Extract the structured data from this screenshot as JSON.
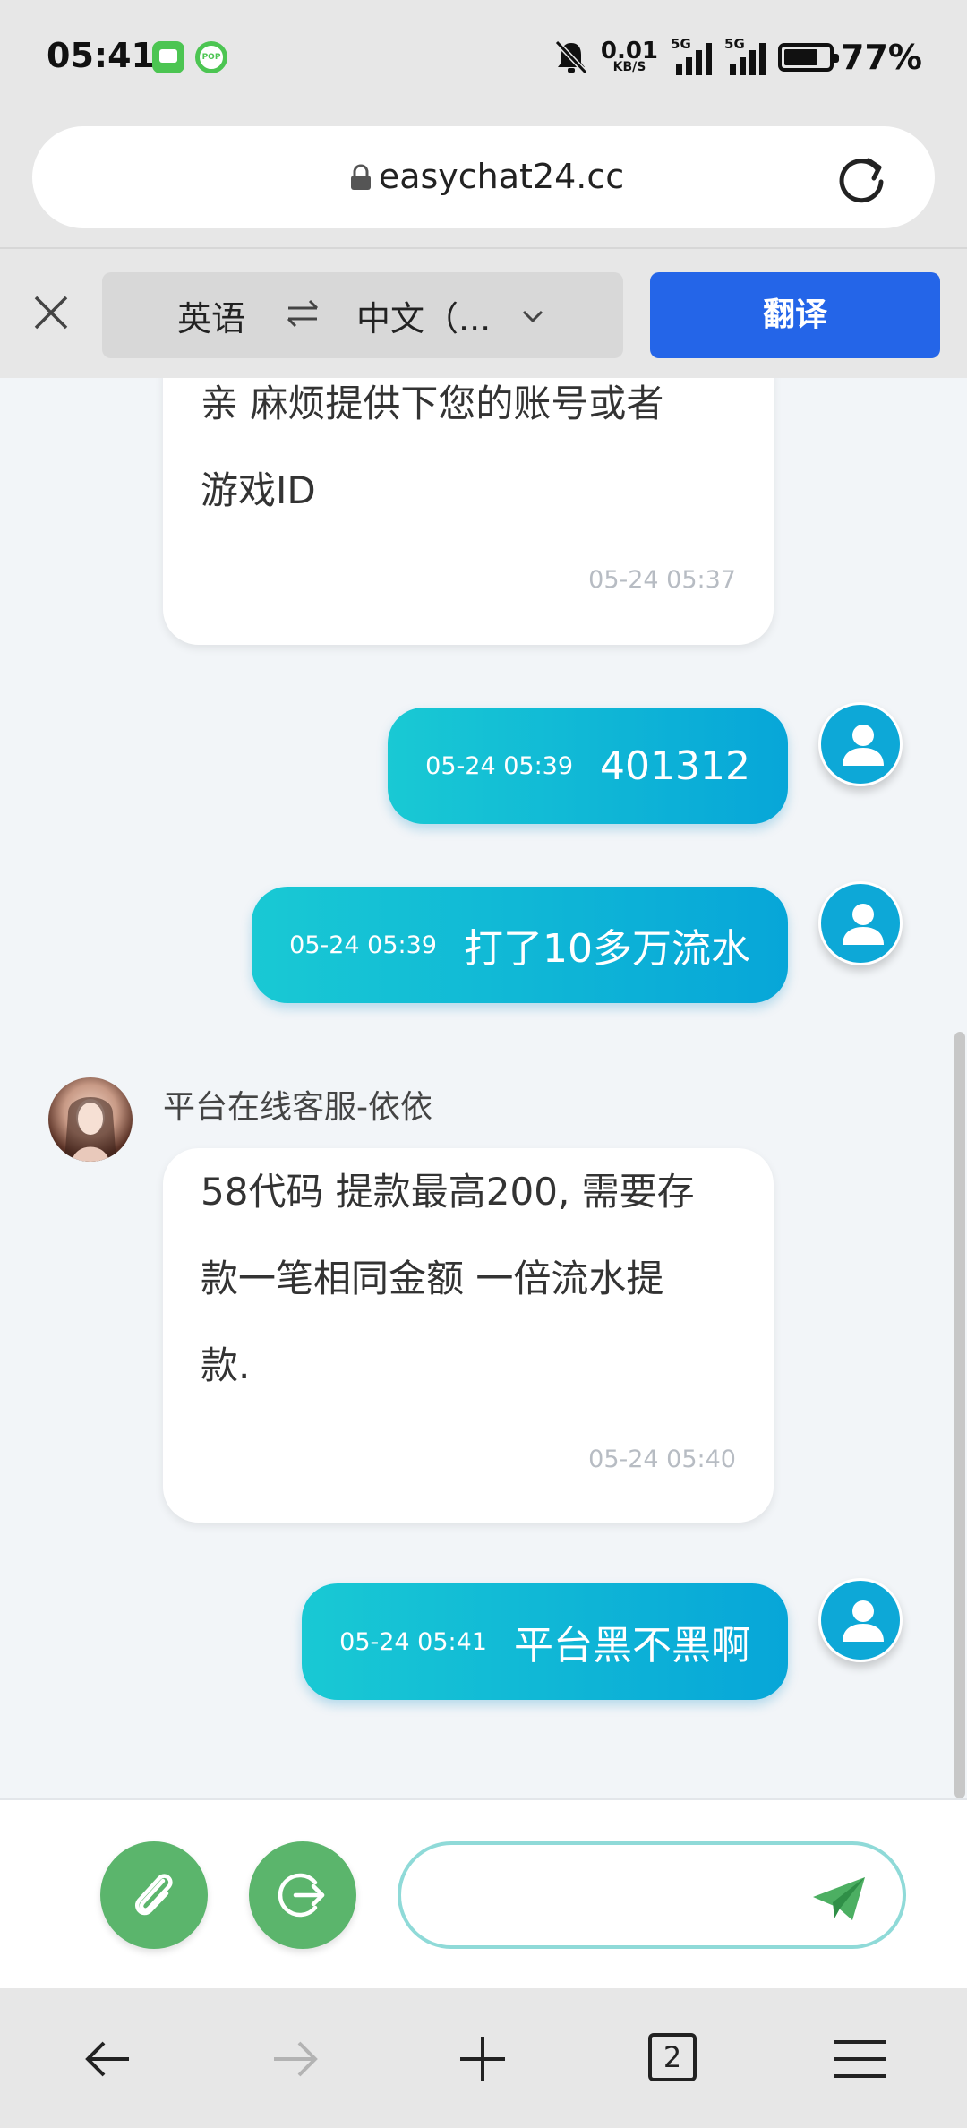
{
  "status_bar": {
    "time": "05:41",
    "net_speed": "0.01",
    "net_unit": "KB/S",
    "sim1": "5G",
    "sim2": "5G",
    "battery": "77%"
  },
  "browser": {
    "url": "easychat24.cc"
  },
  "translate_bar": {
    "source_lang": "英语",
    "target_lang": "中文（...",
    "translate_button": "翻译"
  },
  "chat": {
    "messages": [
      {
        "from": "agent",
        "text_line1": "亲 麻烦提供下您的账号或者",
        "text_line2": "游戏ID",
        "time": "05-24 05:37"
      },
      {
        "from": "user",
        "text": "401312",
        "time": "05-24 05:39"
      },
      {
        "from": "user",
        "text": "打了10多万流水",
        "time": "05-24 05:39"
      },
      {
        "from": "agent",
        "sender": "平台在线客服-依依",
        "text_line1": "58代码 提款最高200, 需要存",
        "text_line2": "款一笔相同金额 一倍流水提",
        "text_line3": "款.",
        "time": "05-24 05:40"
      },
      {
        "from": "user",
        "text": "平台黑不黑啊",
        "time": "05-24 05:41"
      }
    ]
  },
  "composer": {
    "placeholder": ""
  },
  "navbar": {
    "tab_count": "2"
  },
  "colors": {
    "accent_blue": "#2465e8",
    "bubble_start": "#19c9d4",
    "bubble_end": "#07a6d8",
    "green_button": "#5bb56c"
  }
}
